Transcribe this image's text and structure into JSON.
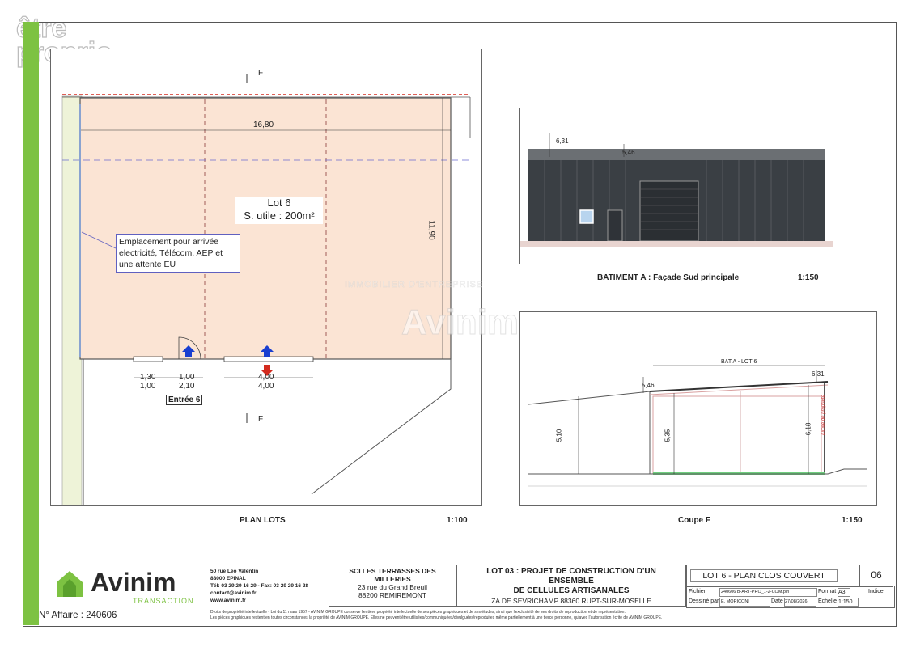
{
  "watermark": {
    "line1": "être",
    "line2": "proprio"
  },
  "plan": {
    "caption": "PLAN LOTS",
    "scale": "1:100",
    "lot_label": "Lot 6",
    "surface_label": "S. utile : 200m²",
    "width_dim": "16,80",
    "height_dim": "11,90",
    "note": "Emplacement pour arrivée electricité, Télécom, AEP et une attente EU",
    "section_mark": "F",
    "dims": {
      "d1": "1,30",
      "d2": "1,00",
      "d3": "1,00",
      "d4": "2,10",
      "d5": "4,00",
      "d6": "4,00"
    },
    "entrance": "Entrée 6"
  },
  "facade": {
    "caption": "BATIMENT A : Façade Sud principale",
    "scale": "1:150",
    "h1": "6,31",
    "h2": "5,46"
  },
  "section": {
    "caption": "Coupe F",
    "scale": "1:150",
    "label": "BAT A - LOT 6",
    "h_left": "5,46",
    "h_right": "6,31",
    "v1": "5,10",
    "v2": "5,35",
    "v3": "6,18",
    "limit": "Limite de propriété"
  },
  "agency_watermark": {
    "line1": "IMMOBILIER D'ENTREPRISE",
    "brand": "Avinim"
  },
  "titleblock": {
    "brand": "Avinim",
    "brand_sub": "TRANSACTION",
    "address_lines": [
      "50 rue Leo Valentin",
      "88000 EPINAL",
      "Tél: 03 29 29 16 29 - Fax: 03 29 29 16 28",
      "contact@avinim.fr",
      "www.avinim.fr"
    ],
    "client_lines": [
      "SCI LES TERRASSES DES",
      "MILLERIES",
      "23 rue du Grand Breuil",
      "88200 REMIREMONT"
    ],
    "project_lines": [
      "LOT 03 : PROJET DE CONSTRUCTION D'UN",
      "ENSEMBLE",
      "DE CELLULES ARTISANALES"
    ],
    "project_addr": "ZA DE SEVRICHAMP 88360 RUPT-SUR-MOSELLE",
    "sheet_title": "LOT 6 - PLAN CLOS COUVERT",
    "sheet_no": "06",
    "fichier_label": "Fichier",
    "fichier_value": "240606 B-ART-PRO_1-2-COM.pln",
    "format_label": "Format",
    "format_value": "A3",
    "indice_label": "Indice",
    "dessine_label": "Dessiné par",
    "dessine_value": "E. MORICONI",
    "date_label": "Date",
    "date_value": "27/08/2026",
    "echelle_label": "Echelle",
    "echelle_value": "1:150",
    "affaire": "N° Affaire : 240606",
    "legal1": "Droits de propriété intellectuelle - Loi du 11 mars 1957 - AVINIM GROUPE conserve l'entière propriété intellectuelle de ses pièces graphiques et de ses études, ainsi que l'exclusivité de ses droits de reproduction et de représentation.",
    "legal2": "Les pièces graphiques restent en toutes circonstances la propriété de AVINIM GROUPE. Elles ne peuvent être utilisées/communiquées/divulguées/reproduites même partiellement à une tierce personne, qu'avec l'autorisation écrite de AVINIM GROUPE."
  },
  "colors": {
    "green": "#7dc242",
    "lot_fill": "#fbe4d4",
    "facade": "#3a3f44",
    "blue_arrow": "#1a3fd0",
    "red_arrow": "#d32a1e"
  }
}
